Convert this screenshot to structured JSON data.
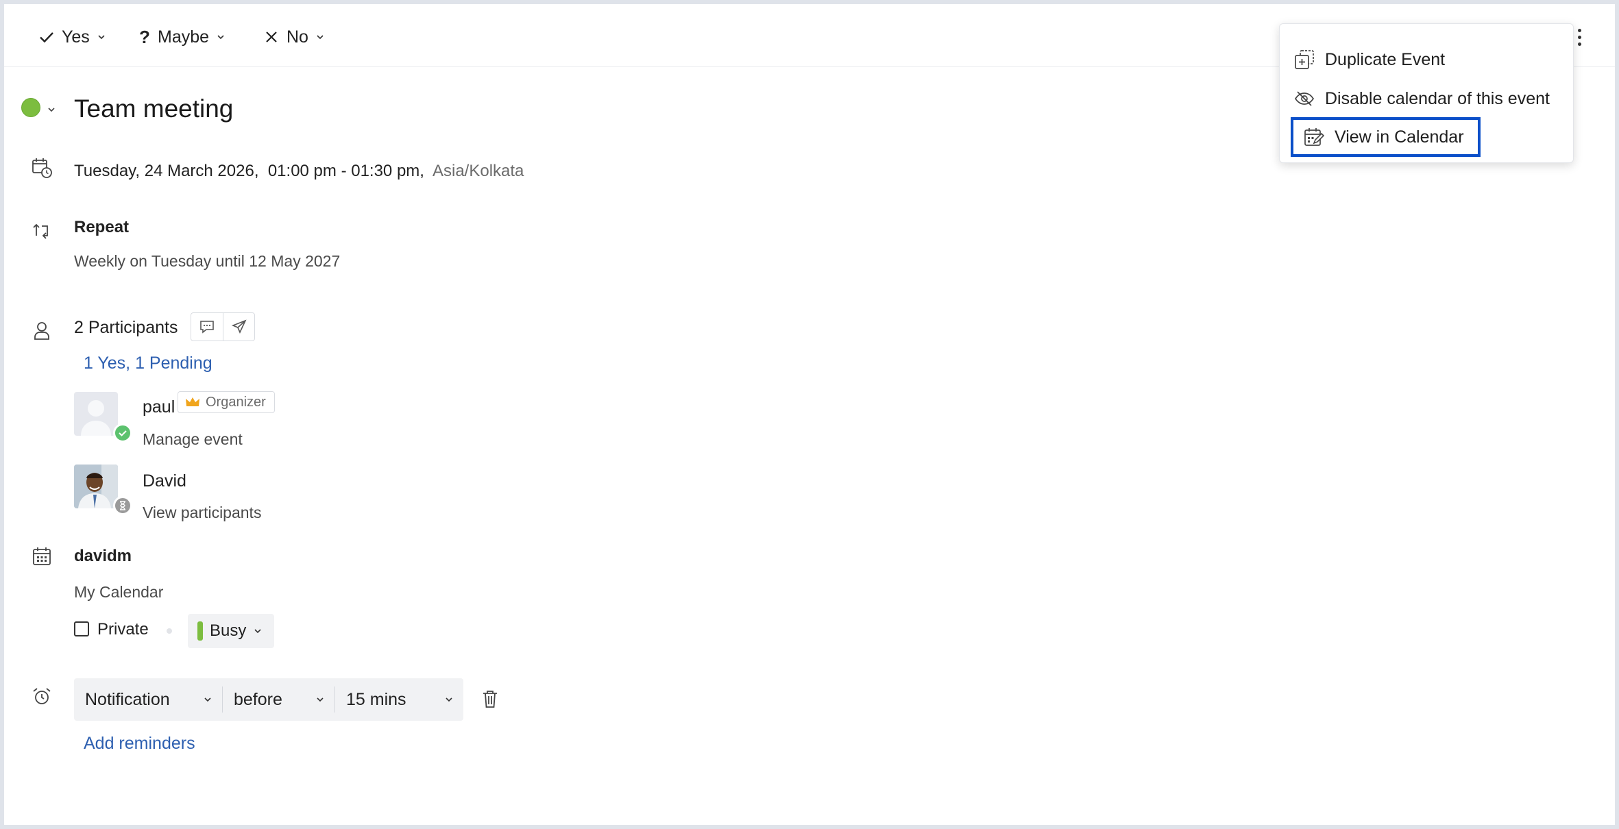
{
  "rsvp": {
    "yes": "Yes",
    "maybe": "Maybe",
    "no": "No"
  },
  "event": {
    "title": "Team meeting",
    "color": "#7cbd3f",
    "date": "Tuesday, 24 March 2026,",
    "time": "01:00 pm  - 01:30 pm,",
    "timezone": "Asia/Kolkata"
  },
  "repeat": {
    "label": "Repeat",
    "rule": "Weekly on Tuesday until 12 May 2027"
  },
  "participants": {
    "count_label": "2 Participants",
    "summary": "1 Yes, 1 Pending",
    "list": [
      {
        "name": "paul",
        "badge": "Organizer",
        "action": "Manage event",
        "status": "accepted"
      },
      {
        "name": "David",
        "action": "View participants",
        "status": "pending"
      }
    ]
  },
  "calendar": {
    "owner": "davidm",
    "name": "My Calendar",
    "private_label": "Private",
    "private_checked": false,
    "availability": "Busy"
  },
  "reminder": {
    "type": "Notification",
    "relation": "before",
    "offset": "15 mins",
    "add_label": "Add reminders"
  },
  "menu": {
    "items": [
      {
        "label": "Duplicate Event",
        "icon": "duplicate-icon"
      },
      {
        "label": "Disable calendar of this event",
        "icon": "eye-off-icon"
      },
      {
        "label": "View in Calendar",
        "icon": "calendar-edit-icon",
        "highlighted": true
      }
    ]
  },
  "colors": {
    "accent_link": "#2d5fb0",
    "highlight_border": "#0b4fc9",
    "accepted": "#5cc26e",
    "pending": "#9a9a9a"
  }
}
